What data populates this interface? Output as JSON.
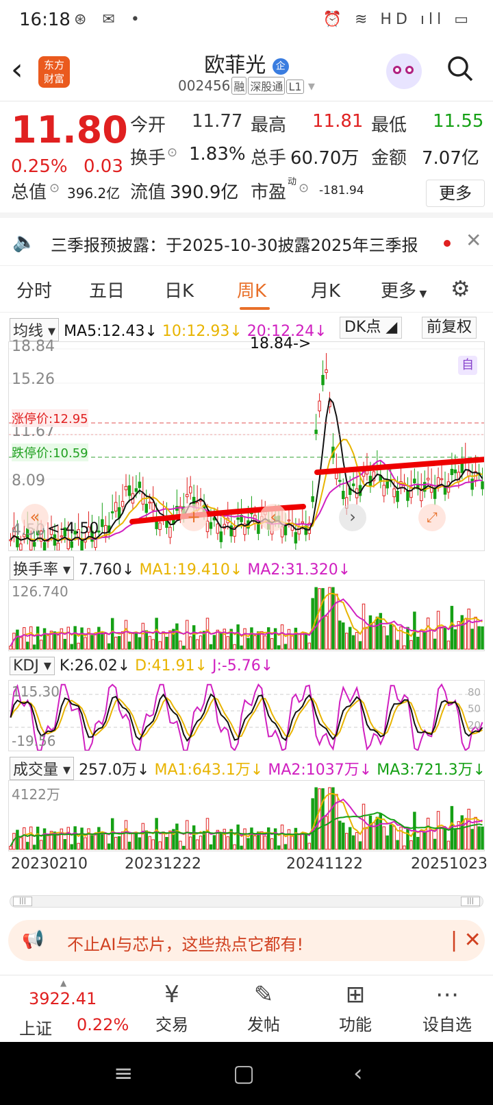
{
  "status_bar": {
    "time": "16:18",
    "left_icons": "⊛ ✉ •",
    "right_icons": "⏰ ≋ HD ıll ▭"
  },
  "header": {
    "stock_name": "欧菲光",
    "badge": "企",
    "code": "002456",
    "tags": [
      "融",
      "深股通",
      "L1"
    ],
    "logo_line1": "东方",
    "logo_line2": "财富"
  },
  "quote": {
    "price": "11.80",
    "change_pct": "0.25%",
    "change_amt": "0.03",
    "open_label": "今开",
    "open": "11.77",
    "high_label": "最高",
    "high": "11.81",
    "low_label": "最低",
    "low": "11.55",
    "turnover_label": "换手",
    "turnover": "1.83%",
    "volume_label": "总手",
    "volume": "60.70万",
    "amount_label": "金额",
    "amount": "7.07亿",
    "mktcap_label": "总值",
    "mktcap": "396.2亿",
    "float_label": "流值",
    "float_cap": "390.9亿",
    "pe_label": "市盈",
    "pe_sup": "动",
    "pe": "-181.94",
    "more": "更多"
  },
  "notice": {
    "text": "三季报预披露：于2025-10-30披露2025年三季报"
  },
  "tabs": [
    "分时",
    "五日",
    "日K",
    "周K",
    "月K",
    "更多"
  ],
  "active_tab": "周K",
  "ma_legend": {
    "selector": "均线",
    "ma5": "MA5:12.43",
    "ma10": "10:12.93",
    "ma20": "20:12.24",
    "dk": "DK点",
    "adjust": "前复权"
  },
  "kchart": {
    "y_labels": [
      "18.84",
      "15.26",
      "11.67",
      "8.09"
    ],
    "limit_up": "涨停价:12.95",
    "limit_down": "跌停价:10.59",
    "max_marker": "18.84->",
    "min_marker": "<-4.50",
    "low_tick": "4.50",
    "self_label": "自"
  },
  "turnover_legend": {
    "selector": "换手率",
    "value": "7.760",
    "ma1": "MA1:19.410",
    "ma2": "MA2:31.320",
    "ymax": "126.740"
  },
  "kdj_legend": {
    "selector": "KDJ",
    "k": "K:26.02",
    "d": "D:41.91",
    "j": "J:-5.76",
    "ymax": "115.30",
    "ymin": "-19.56",
    "lvl80": "80",
    "lvl50": "50",
    "lvl20": "20"
  },
  "vol_legend": {
    "selector": "成交量",
    "value": "257.0万",
    "ma1": "MA1:643.1万",
    "ma2": "MA2:1037万",
    "ma3": "MA3:721.3万",
    "ymax": "4122万"
  },
  "x_dates": [
    "20230210",
    "20231222",
    "20241122",
    "20251023"
  ],
  "banner": {
    "text": "不止AI与芯片，这些热点它都有!"
  },
  "bottom_nav": {
    "index_value": "3922.41",
    "index_name": "上证",
    "index_pct": "0.22%",
    "items": [
      "交易",
      "发帖",
      "功能",
      "设自选"
    ]
  },
  "colors": {
    "up": "#e02020",
    "down": "#15a015",
    "ma5": "#111111",
    "ma10": "#e8b400",
    "ma20": "#d020c0",
    "accent": "#e8702a"
  }
}
